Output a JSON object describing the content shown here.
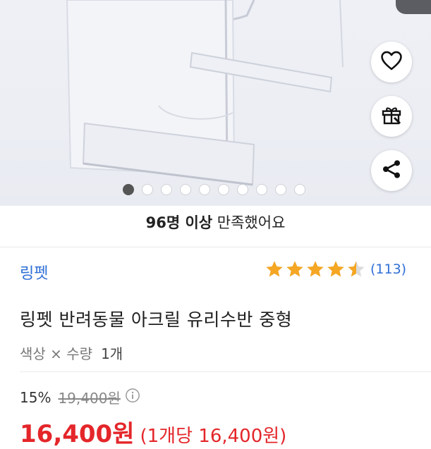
{
  "actions": {
    "like_icon": "heart-icon",
    "gift_icon": "gift-icon",
    "share_icon": "share-icon"
  },
  "carousel": {
    "total": 10,
    "active_index": 0
  },
  "satisfaction": {
    "bold": "96명 이상",
    "rest": " 만족했어요"
  },
  "brand": "링펫",
  "rating": {
    "value": 4.5,
    "count_text": "(113)"
  },
  "product": {
    "title": "링펫 반려동물 아크릴 유리수반 중형"
  },
  "option": {
    "label": "색상 × 수량",
    "value": "1개"
  },
  "price": {
    "discount": "15%",
    "original": "19,400원",
    "final": "16,400원",
    "unit": "(1개당 16,400원)"
  },
  "colors": {
    "accent_blue": "#2f6fd6",
    "star": "#f5a623",
    "sale_red": "#e4262a"
  }
}
